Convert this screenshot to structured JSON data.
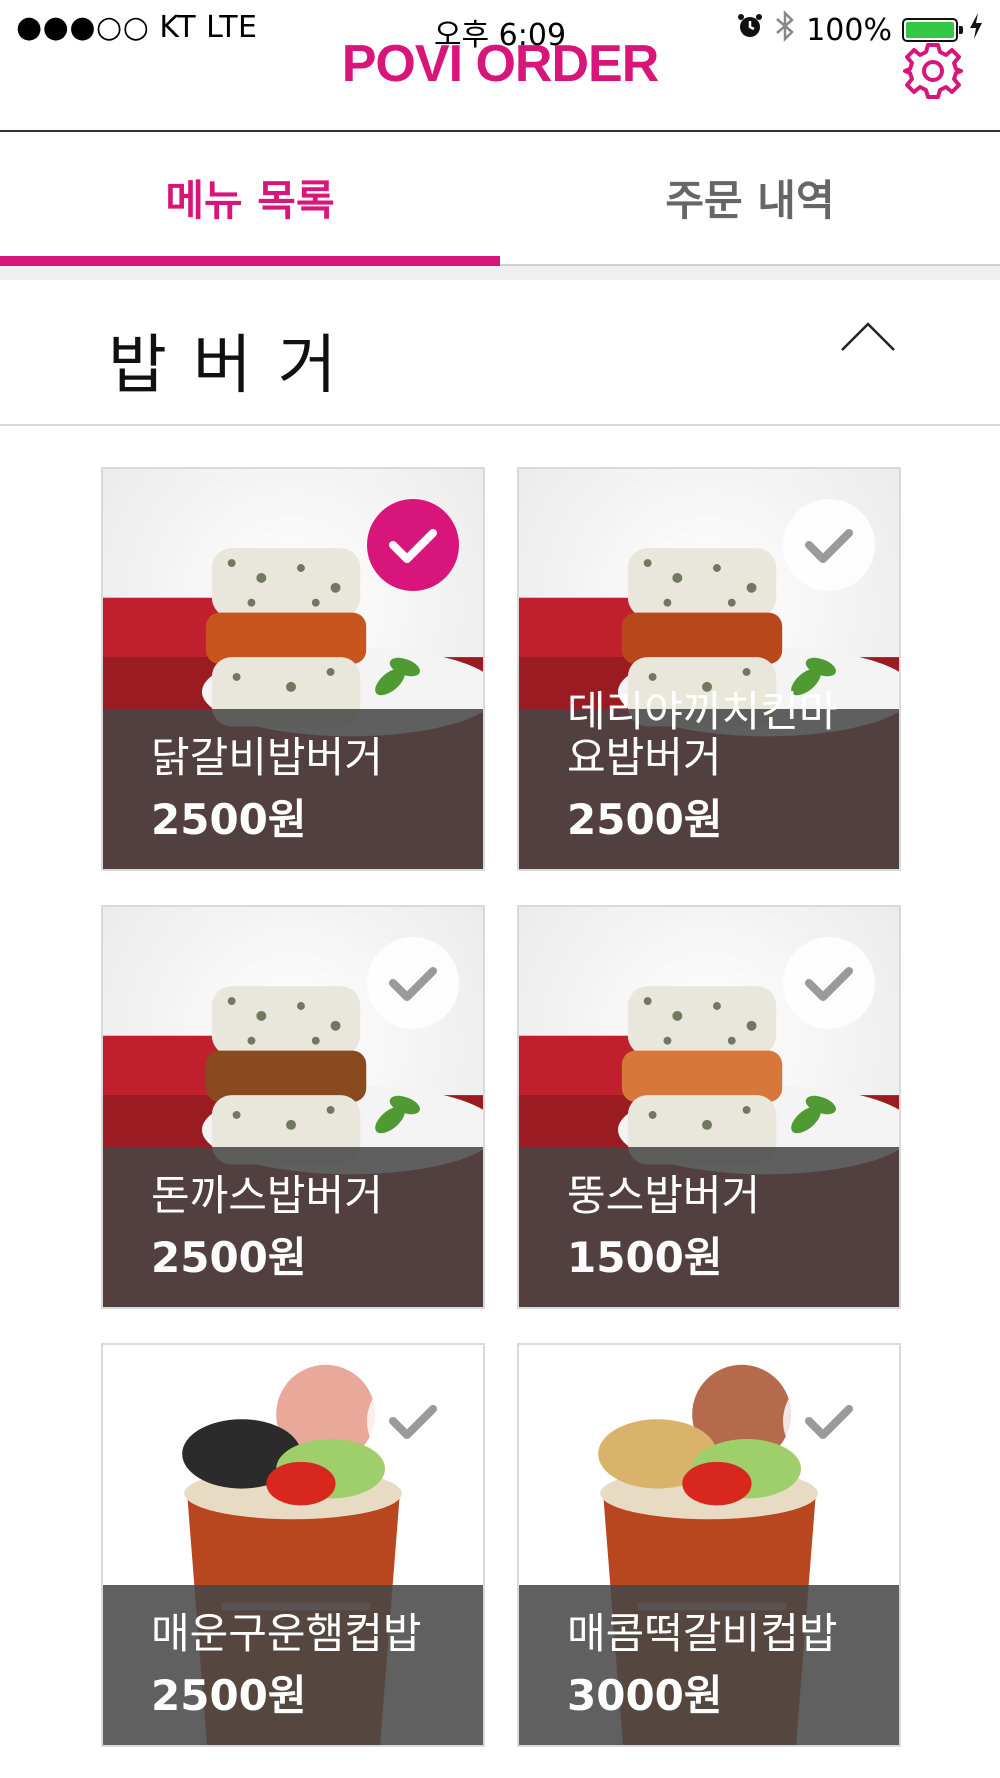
{
  "status_bar": {
    "carrier": "●●●○○ KT   LTE",
    "time": "오후 6:09",
    "battery": "100%",
    "battery_level": 1.0,
    "icons": [
      "alarm-icon",
      "bluetooth-icon",
      "battery-icon",
      "charging-icon"
    ]
  },
  "header": {
    "title": "POVI ORDER",
    "settings_icon": "gear-icon"
  },
  "tabs": [
    {
      "label": "메뉴 목록",
      "active": true
    },
    {
      "label": "주문 내역",
      "active": false
    }
  ],
  "category": {
    "title": "밥버거",
    "expanded": true,
    "toggle_icon": "chevron-up-icon"
  },
  "colors": {
    "accent": "#d8157a",
    "inactive_tab": "#666666",
    "overlay": "#464646"
  },
  "menu_items": [
    {
      "name": "닭갈비밥버거",
      "price": "2500원",
      "selected": true,
      "photo": "rice-burger-photo"
    },
    {
      "name": "데리야끼치킨마요밥버거",
      "price": "2500원",
      "selected": false,
      "photo": "rice-burger-photo"
    },
    {
      "name": "돈까스밥버거",
      "price": "2500원",
      "selected": false,
      "photo": "rice-burger-photo"
    },
    {
      "name": "뚱스밥버거",
      "price": "1500원",
      "selected": false,
      "photo": "rice-burger-photo"
    },
    {
      "name": "매운구운햄컵밥",
      "price": "2500원",
      "selected": false,
      "photo": "cup-rice-photo"
    },
    {
      "name": "매콤떡갈비컵밥",
      "price": "3000원",
      "selected": false,
      "photo": "cup-rice-photo"
    }
  ]
}
